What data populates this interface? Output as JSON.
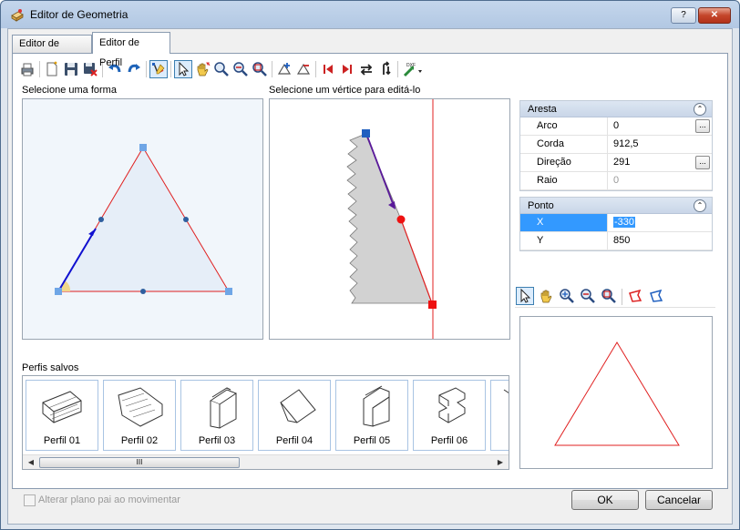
{
  "window": {
    "title": "Editor de Geometria",
    "help_label": "?",
    "close_label": "✕"
  },
  "tabs": [
    {
      "label": "Editor de Forma",
      "active": false
    },
    {
      "label": "Editor de Perfil",
      "active": true
    }
  ],
  "toolbar": {
    "icons": [
      "print-icon",
      "new-icon",
      "save-icon",
      "delete-icon",
      "undo-icon",
      "redo-icon",
      "edit-vertex-icon",
      "select-arrow-icon",
      "pan-hand-icon",
      "zoom-icon",
      "zoom-out-icon",
      "zoom-window-icon",
      "add-vertex-icon",
      "remove-vertex-icon",
      "first-vertex-icon",
      "last-vertex-icon",
      "flip-horizontal-icon",
      "flip-vertical-icon",
      "dxf-import-icon"
    ]
  },
  "left_panel": {
    "label": "Selecione uma forma"
  },
  "middle_panel": {
    "label": "Selecione um vértice para editá-lo"
  },
  "properties": {
    "aresta": {
      "header": "Aresta",
      "collapse_glyph": "⌃",
      "rows": [
        {
          "key": "Arco",
          "value": "0",
          "has_button": true
        },
        {
          "key": "Corda",
          "value": "912,5",
          "has_button": false
        },
        {
          "key": "Direção",
          "value": "291",
          "has_button": true
        },
        {
          "key": "Raio",
          "value": "0",
          "has_button": false,
          "disabled": true
        }
      ]
    },
    "ponto": {
      "header": "Ponto",
      "collapse_glyph": "⌃",
      "rows": [
        {
          "key": "X",
          "value": "-330",
          "selected": true
        },
        {
          "key": "Y",
          "value": "850",
          "selected": false
        }
      ]
    },
    "button_glyph": "..."
  },
  "preview_toolbar": {
    "icons": [
      "select-arrow-icon",
      "pan-hand-icon",
      "zoom-in-icon",
      "zoom-out-icon",
      "zoom-window-icon",
      "shape-red-icon",
      "shape-blue-icon"
    ]
  },
  "saved_profiles": {
    "label": "Perfis salvos",
    "items": [
      "Perfil 01",
      "Perfil 02",
      "Perfil 03",
      "Perfil 04",
      "Perfil 05",
      "Perfil 06"
    ],
    "scroll_thumb_glyph": "III"
  },
  "footer": {
    "checkbox_label": "Alterar plano pai ao movimentar",
    "ok_label": "OK",
    "cancel_label": "Cancelar"
  },
  "colors": {
    "accent_blue": "#3399ff",
    "edge_red": "#e02020",
    "vertex_blue": "#1f5fbf",
    "profile_fill": "#d2d2d2",
    "shape_fill": "#eaf0f8"
  }
}
